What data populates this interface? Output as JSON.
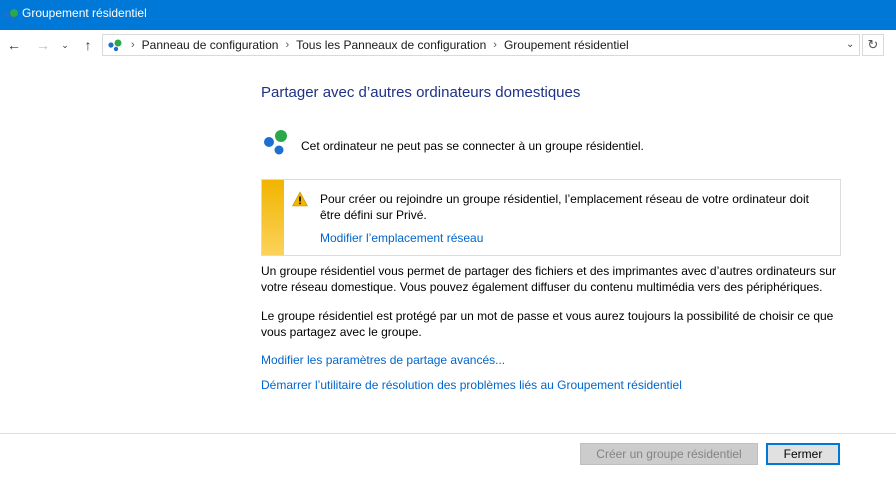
{
  "window": {
    "title": "Groupement résidentiel"
  },
  "nav": {
    "back_icon": "arrow-left-icon",
    "forward_icon": "arrow-right-icon",
    "recent_icon": "chevron-down-icon",
    "up_icon": "arrow-up-icon",
    "refresh_icon": "refresh-icon",
    "separator": "›",
    "breadcrumbs": [
      "Panneau de configuration",
      "Tous les Panneaux de configuration",
      "Groupement résidentiel"
    ]
  },
  "main": {
    "heading": "Partager avec d’autres ordinateurs domestiques",
    "status_text": "Cet ordinateur ne peut pas se connecter à un groupe résidentiel.",
    "warning": {
      "text": "Pour créer ou rejoindre un groupe résidentiel, l’emplacement réseau de votre ordinateur doit être défini sur Privé.",
      "link": "Modifier l’emplacement réseau",
      "icon": "warning-icon",
      "accent": "#f1b400"
    },
    "paragraph1": "Un groupe résidentiel vous permet de partager des fichiers et des imprimantes avec d’autres ordinateurs sur votre réseau domestique. Vous pouvez également diffuser du contenu multimédia vers des périphériques.",
    "paragraph2": "Le groupe résidentiel est protégé par un mot de passe et vous aurez toujours la possibilité de choisir ce que vous partagez avec le groupe.",
    "link_advanced": "Modifier les paramètres de partage avancés...",
    "link_troubleshoot": "Démarrer l’utilitaire de résolution des problèmes liés au Groupement résidentiel"
  },
  "footer": {
    "create_label": "Créer un groupe résidentiel",
    "close_label": "Fermer"
  },
  "colors": {
    "titlebar": "#0078d7",
    "heading": "#1e3287",
    "link": "#0066cc"
  }
}
